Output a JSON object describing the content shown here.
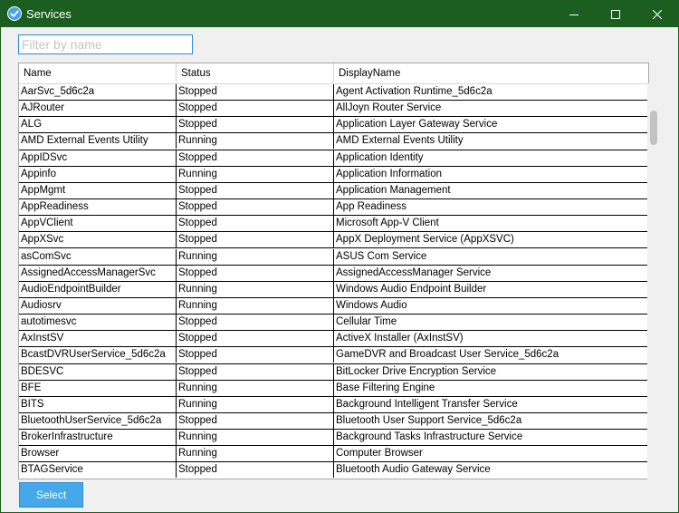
{
  "window": {
    "title": "Services"
  },
  "filter": {
    "placeholder": "Filter by name",
    "value": ""
  },
  "grid": {
    "columns": [
      "Name",
      "Status",
      "DisplayName"
    ],
    "rows": [
      [
        "AarSvc_5d6c2a",
        "Stopped",
        "Agent Activation Runtime_5d6c2a"
      ],
      [
        "AJRouter",
        "Stopped",
        "AllJoyn Router Service"
      ],
      [
        "ALG",
        "Stopped",
        "Application Layer Gateway Service"
      ],
      [
        "AMD External Events Utility",
        "Running",
        "AMD External Events Utility"
      ],
      [
        "AppIDSvc",
        "Stopped",
        "Application Identity"
      ],
      [
        "Appinfo",
        "Running",
        "Application Information"
      ],
      [
        "AppMgmt",
        "Stopped",
        "Application Management"
      ],
      [
        "AppReadiness",
        "Stopped",
        "App Readiness"
      ],
      [
        "AppVClient",
        "Stopped",
        "Microsoft App-V Client"
      ],
      [
        "AppXSvc",
        "Stopped",
        "AppX Deployment Service (AppXSVC)"
      ],
      [
        "asComSvc",
        "Running",
        "ASUS Com Service"
      ],
      [
        "AssignedAccessManagerSvc",
        "Stopped",
        "AssignedAccessManager Service"
      ],
      [
        "AudioEndpointBuilder",
        "Running",
        "Windows Audio Endpoint Builder"
      ],
      [
        "Audiosrv",
        "Running",
        "Windows Audio"
      ],
      [
        "autotimesvc",
        "Stopped",
        "Cellular Time"
      ],
      [
        "AxInstSV",
        "Stopped",
        "ActiveX Installer (AxInstSV)"
      ],
      [
        "BcastDVRUserService_5d6c2a",
        "Stopped",
        "GameDVR and Broadcast User Service_5d6c2a"
      ],
      [
        "BDESVC",
        "Stopped",
        "BitLocker Drive Encryption Service"
      ],
      [
        "BFE",
        "Running",
        "Base Filtering Engine"
      ],
      [
        "BITS",
        "Running",
        "Background Intelligent Transfer Service"
      ],
      [
        "BluetoothUserService_5d6c2a",
        "Stopped",
        "Bluetooth User Support Service_5d6c2a"
      ],
      [
        "BrokerInfrastructure",
        "Running",
        "Background Tasks Infrastructure Service"
      ],
      [
        "Browser",
        "Running",
        "Computer Browser"
      ],
      [
        "BTAGService",
        "Stopped",
        "Bluetooth Audio Gateway Service"
      ]
    ]
  },
  "select_button": {
    "label": "Select"
  },
  "colors": {
    "titlebar": "#1b5e20",
    "accent": "#45a8ea",
    "filter_border": "#2e8bd8"
  }
}
